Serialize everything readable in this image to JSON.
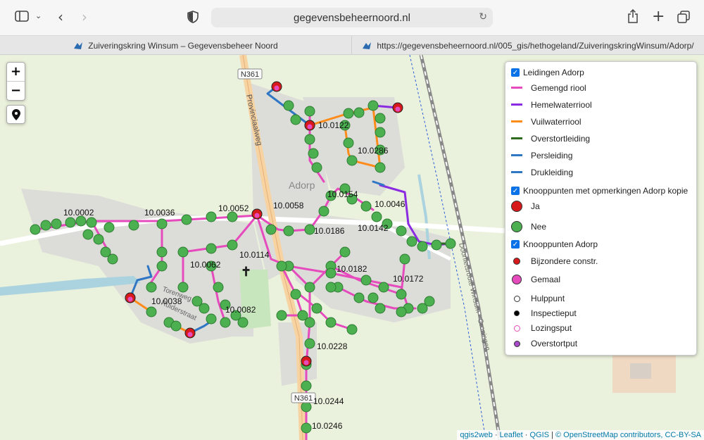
{
  "browser": {
    "url": "gegevensbeheernoord.nl",
    "tabs": [
      {
        "label": "Zuiveringskring Winsum – Gegevensbeheer Noord"
      },
      {
        "label": "https://gegevensbeheernoord.nl/005_gis/hethogeland/ZuiveringskringWinsum/Adorp/"
      }
    ]
  },
  "map": {
    "road_labels": [
      "N361",
      "Provinciaalweg",
      "N361",
      "Doorfietsroute Winsum - Groningen",
      "Torenweg",
      "Ruiderstraat"
    ],
    "place_label": "Adorp",
    "node_labels": [
      "10.0122",
      "10.0286",
      "10.0002",
      "10.0036",
      "10.0052",
      "10.0058",
      "10.0154",
      "10.0046",
      "10.0186",
      "10.0142",
      "10.0114",
      "10.0062",
      "10.0182",
      "10.0172",
      "10.0038",
      "10.0082",
      "10.0228",
      "10.0244",
      "10.0246"
    ],
    "zoom_in": "+",
    "zoom_out": "−",
    "locate_icon": "marker-icon"
  },
  "legend": {
    "group1": {
      "title": "Leidingen Adorp",
      "items": [
        {
          "label": "Gemengd riool",
          "color": "#e64bbd"
        },
        {
          "label": "Hemelwaterriool",
          "color": "#8a2be2"
        },
        {
          "label": "Vuilwaterriool",
          "color": "#ff8c1a"
        },
        {
          "label": "Overstortleiding",
          "color": "#2e6b1f"
        },
        {
          "label": "Persleiding",
          "color": "#2f76c4"
        },
        {
          "label": "Drukleiding",
          "color": "#2f76c4"
        }
      ]
    },
    "group2": {
      "title": "Knooppunten met opmerkingen Adorp kopie",
      "items": [
        {
          "label": "Ja",
          "color": "#d7191c"
        },
        {
          "label": "Nee",
          "color": "#4caf50"
        }
      ]
    },
    "group3": {
      "title": "Knooppunten Adorp",
      "items": [
        {
          "label": "Bijzondere constr.",
          "color": "#d7191c"
        },
        {
          "label": "Gemaal",
          "color": "#e64bbd"
        },
        {
          "label": "Hulppunt",
          "color": "#333333"
        },
        {
          "label": "Inspectieput",
          "color": "#000000"
        },
        {
          "label": "Lozingsput",
          "color": "#e64bbd"
        },
        {
          "label": "Overstortput",
          "color": "#a64ac9"
        }
      ]
    }
  },
  "attribution": {
    "qgis2web": "qgis2web",
    "leaflet": "Leaflet",
    "qgis": "QGIS",
    "osm": "© OpenStreetMap contributors, CC-BY-SA"
  }
}
